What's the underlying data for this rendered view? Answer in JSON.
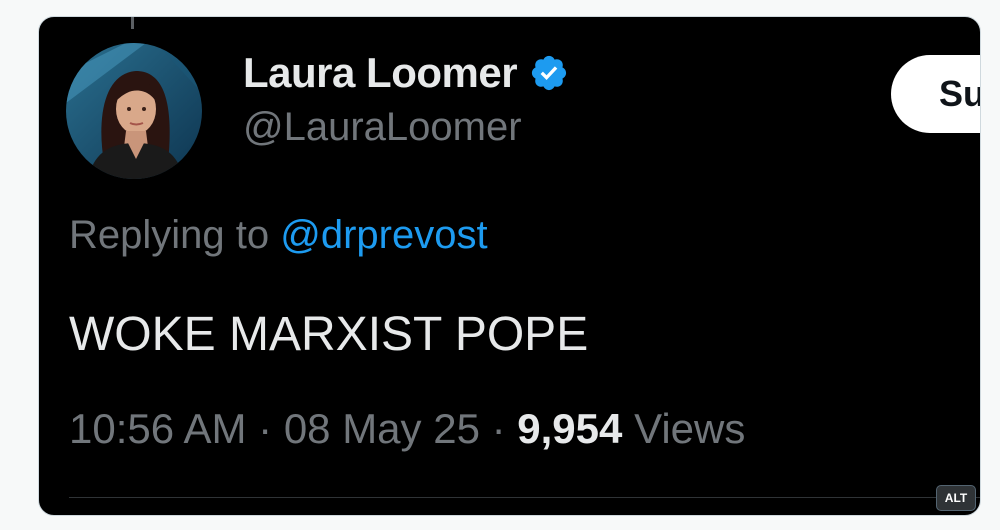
{
  "tweet": {
    "author": {
      "display_name": "Laura Loomer",
      "handle": "@LauraLoomer",
      "verified": true,
      "verified_color": "#1d9bf0"
    },
    "subscribe_label": "Su",
    "replying_to_prefix": "Replying to",
    "replying_to_handle": "@drprevost",
    "text": "WOKE MARXIST POPE",
    "time": "10:56 AM",
    "separator_1": "·",
    "date": "08 May 25",
    "separator_2": "·",
    "views_count": "9,954",
    "views_label": "Views"
  },
  "alt_badge": "ALT",
  "colors": {
    "card_background": "#000000",
    "primary_text": "#e7e9ea",
    "secondary_text": "#71767b",
    "link": "#1d9bf0",
    "page_background": "#f7f9f9"
  },
  "icons": {
    "verified": "verified-badge-icon",
    "avatar": "profile-photo"
  }
}
